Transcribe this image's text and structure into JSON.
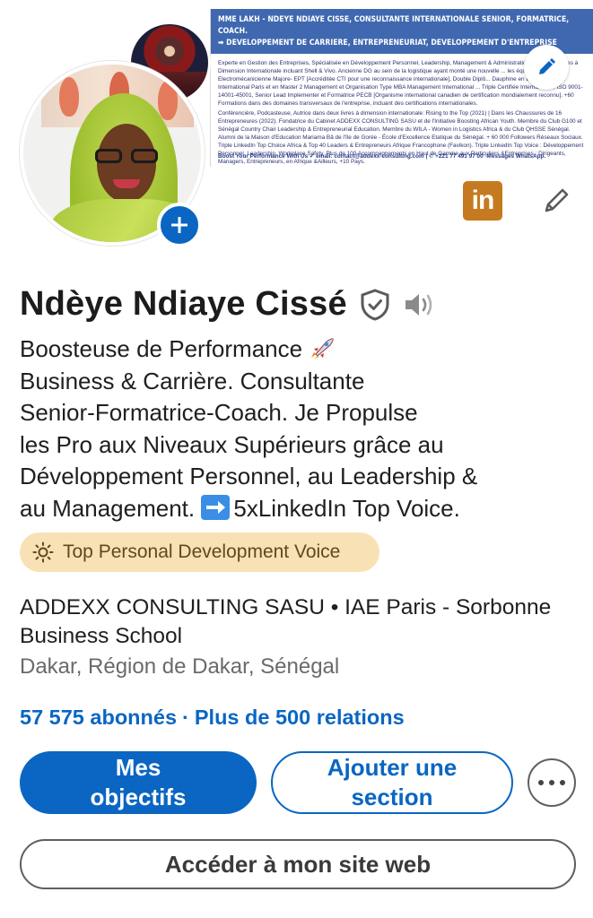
{
  "banner": {
    "title_line1": "MME LAKH - NDEYE NDIAYE CISSE, CONSULTANTE INTERNATIONALE SENIOR, FORMATRICE, COACH.",
    "title_line2": "➡ DEVELOPPEMENT DE CARRIERE, ENTREPRENEURIAT, DEVELOPPEMENT D'ENTREPRISE",
    "body_p1": "Experte en Gestion des Entreprises, Spécialisée en Développement Personnel, Leadership, Management & Administration ... d'Expériences à Dimension Internationale incluant Shell & Vivo. Ancienne DG au sein de la logistique ayant monté une nouvelle ... les équipes. Ingénieure Electromécanicienne Majore- EPT [Accréditée CTI pour une reconnaissance internationale], Double Diplô... Dauphine en Exécutive MBA International Paris et en Master 2 Management et Organisation Type MBA Management International ... Triple Certifiée Internationale ISO 9001-14001-45001, Senior Lead Implementer et Formatrice PECB [Organisme international canadien de certification mondialement reconnu]. +60 Formations dans des domaines transversaux de l'entreprise, incluant des certifications internationales.",
    "body_p2": "Conférencière, Podcasteuse, Autrice dans deux livres à dimension internationale: Rising to the Top (2021) | Dans les Chaussures de 16 Entrepreneures (2022). Fondatrice du Cabinet ADDEXX CONSULTING SASU et de l'Initiative Boosting African Youth. Membre du Club G100 et Sénégal Country Chair Leadership & Entrepreneurial Education. Membre du WILA - Women in Logistics Africa & du Club QHSSE Sénégal. Alumni de la Maison d'Education Mariama Bâ de l'île de Gorée - École d'Excellence Etatique du Sénégal. + 60 000 Followers Réseaux Sociaux. Triple LinkedIn Top Choice Africa & Top 40 Leaders & Entrepreneurs Afrique Francophone (Favikon). Triple LinkedIn Top Voice : Développement Personnel, Leadership, Workplace Safety. Plus de 100 Accompagnements en Haut de Gamme aux Particuliers &Entreprises : Dirigeants, Managers, Entrepreneurs, en Afrique &Ailleurs, +10 Pays.",
    "footer": "Boost Your Performance With Us ✔ email: contact@addexx-consulting.com | ✆ +221 77 491 97 00 -Messages WhatsApp."
  },
  "profile": {
    "name": "Ndèye Ndiaye Cissé",
    "headline_l1": "Boosteuse de Performance",
    "headline_l2": "Business & Carrière. Consultante",
    "headline_l3": "Senior-Formatrice-Coach. Je Propulse",
    "headline_l4": "les Pro aux Niveaux Supérieurs grâce au",
    "headline_l5": "Développement Personnel, au Leadership &",
    "headline_l6a": "au Management.",
    "headline_l6b": "5xLinkedIn Top Voice.",
    "voice_badge": "Top Personal Development Voice",
    "company_line1": "ADDEXX CONSULTING SASU • IAE Paris - Sorbonne",
    "company_line2": "Business School",
    "location": "Dakar, Région de Dakar, Sénégal",
    "followers": "57 575 abonnés",
    "separator": "·",
    "connections": "Plus de 500 relations"
  },
  "actions": {
    "primary_line1": "Mes",
    "primary_line2": "objectifs",
    "secondary_line1": "Ajouter une",
    "secondary_line2": "section",
    "website": "Accéder à mon site web"
  },
  "badges": {
    "linkedin_text": "in"
  },
  "colors": {
    "brand_blue": "#0a66c2",
    "voice_badge_bg": "#f8e1b5",
    "linkedin_badge": "#c67a1f",
    "banner_header": "#3f68b0"
  }
}
